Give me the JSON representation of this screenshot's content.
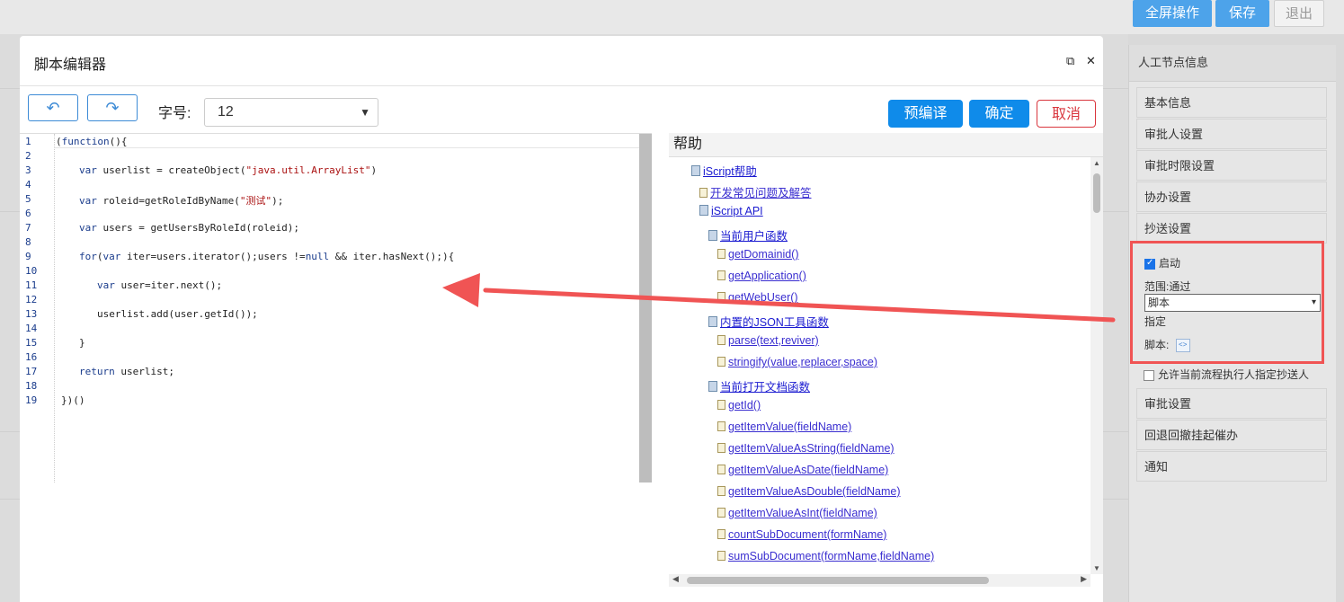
{
  "top_buttons": {
    "fullscreen": "全屏操作",
    "save": "保存",
    "exit": "退出"
  },
  "right_panel": {
    "title": "人工节点信息",
    "items": [
      "基本信息",
      "审批人设置",
      "审批时限设置",
      "协办设置",
      "抄送设置"
    ],
    "enable_label": "启动",
    "enable_checked": true,
    "scope_label": "范围:通过",
    "scope_value": "脚本",
    "assign_label": "指定",
    "script_label": "脚本:",
    "allow_label": "允许当前流程执行人指定抄送人",
    "items_after": [
      "审批设置",
      "回退回撤挂起催办",
      "通知"
    ]
  },
  "modal": {
    "title": "脚本编辑器",
    "font_size_label": "字号:",
    "font_size_value": "12",
    "precompile": "预编译",
    "confirm": "确定",
    "cancel": "取消"
  },
  "code_lines": [
    {
      "n": "1",
      "t": "(function(){"
    },
    {
      "n": "2",
      "t": ""
    },
    {
      "n": "3",
      "t": "var userlist = createObject(\"java.util.ArrayList\")"
    },
    {
      "n": "4",
      "t": ""
    },
    {
      "n": "5",
      "t": "var roleid=getRoleIdByName(\"测试\");"
    },
    {
      "n": "6",
      "t": ""
    },
    {
      "n": "7",
      "t": "var users = getUsersByRoleId(roleid);"
    },
    {
      "n": "8",
      "t": ""
    },
    {
      "n": "9",
      "t": "for(var iter=users.iterator();users !=null && iter.hasNext();){"
    },
    {
      "n": "10",
      "t": ""
    },
    {
      "n": "11",
      "t": "var user=iter.next();"
    },
    {
      "n": "12",
      "t": ""
    },
    {
      "n": "13",
      "t": "userlist.add(user.getId());"
    },
    {
      "n": "14",
      "t": ""
    },
    {
      "n": "15",
      "t": "}"
    },
    {
      "n": "16",
      "t": ""
    },
    {
      "n": "17",
      "t": "return userlist;"
    },
    {
      "n": "18",
      "t": ""
    },
    {
      "n": "19",
      "t": "})()"
    }
  ],
  "help": {
    "title": "帮助",
    "tree": [
      {
        "label": "iScript帮助",
        "icon": "book"
      },
      {
        "label": "开发常见问题及解答",
        "icon": "doc"
      },
      {
        "label": "iScript API",
        "icon": "book"
      },
      {
        "label": "当前用户函数",
        "icon": "book"
      },
      {
        "label": "getDomainid()",
        "icon": "doc"
      },
      {
        "label": "getApplication()",
        "icon": "doc"
      },
      {
        "label": "getWebUser()",
        "icon": "doc"
      },
      {
        "label": "内置的JSON工具函数",
        "icon": "book"
      },
      {
        "label": "parse(text,reviver)",
        "icon": "doc"
      },
      {
        "label": "stringify(value,replacer,space)",
        "icon": "doc"
      },
      {
        "label": "当前打开文档函数",
        "icon": "book"
      },
      {
        "label": "getId()",
        "icon": "doc"
      },
      {
        "label": "getItemValue(fieldName)",
        "icon": "doc"
      },
      {
        "label": "getItemValueAsString(fieldName)",
        "icon": "doc"
      },
      {
        "label": "getItemValueAsDate(fieldName)",
        "icon": "doc"
      },
      {
        "label": "getItemValueAsDouble(fieldName)",
        "icon": "doc"
      },
      {
        "label": "getItemValueAsInt(fieldName)",
        "icon": "doc"
      },
      {
        "label": "countSubDocument(formName)",
        "icon": "doc"
      },
      {
        "label": "sumSubDocument(formName,fieldName)",
        "icon": "doc"
      }
    ]
  },
  "colors": {
    "primary": "#0f8bea",
    "danger": "#d9363e",
    "annotation": "#f05454"
  }
}
